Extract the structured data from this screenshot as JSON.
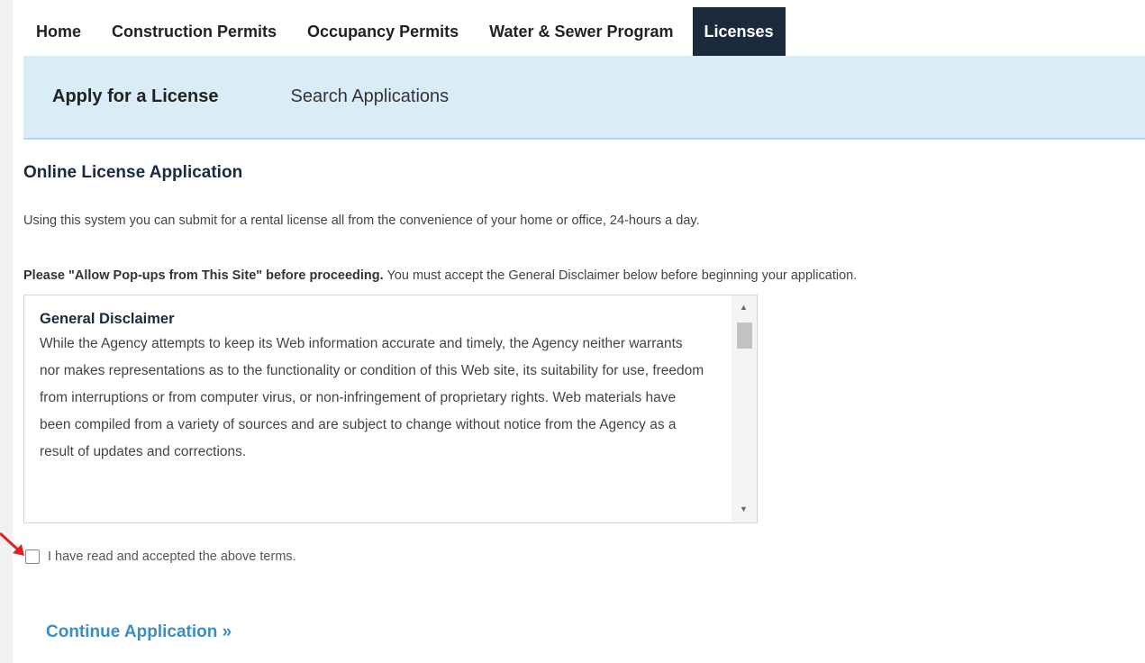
{
  "nav": {
    "tabs": [
      {
        "label": "Home"
      },
      {
        "label": "Construction Permits"
      },
      {
        "label": "Occupancy Permits"
      },
      {
        "label": "Water & Sewer Program"
      },
      {
        "label": "Licenses",
        "active": true
      }
    ]
  },
  "subnav": {
    "items": [
      {
        "label": "Apply for a License",
        "active": true
      },
      {
        "label": "Search Applications"
      }
    ]
  },
  "main": {
    "heading": "Online License Application",
    "intro": "Using this system you can submit for a rental license all from the convenience of your home or office, 24-hours a day.",
    "popup_note_bold": "Please \"Allow Pop-ups from This Site\" before proceeding.",
    "popup_note_rest": " You must accept the General Disclaimer below before beginning your application.",
    "disclaimer": {
      "title": "General Disclaimer",
      "text": "While the Agency attempts to keep its Web information accurate and timely, the Agency neither warrants nor makes representations as to the functionality or condition of this Web site, its suitability for use, freedom from interruptions or from computer virus, or non-infringement of proprietary rights. Web materials have been compiled from a variety of sources and are subject to change without notice from the Agency as a result of updates and corrections."
    },
    "terms_label": "I have read and accepted the above terms.",
    "terms_checked": false,
    "continue_label": "Continue Application »"
  },
  "colors": {
    "nav_active_bg": "#1b2a3d",
    "subnav_bg": "#d8edf8",
    "link": "#3a8ec8",
    "pointer_arrow": "#e02020"
  },
  "icons": {
    "pointer": "red-arrow-icon",
    "scroll_up": "triangle-up-icon",
    "scroll_down": "triangle-down-icon"
  }
}
